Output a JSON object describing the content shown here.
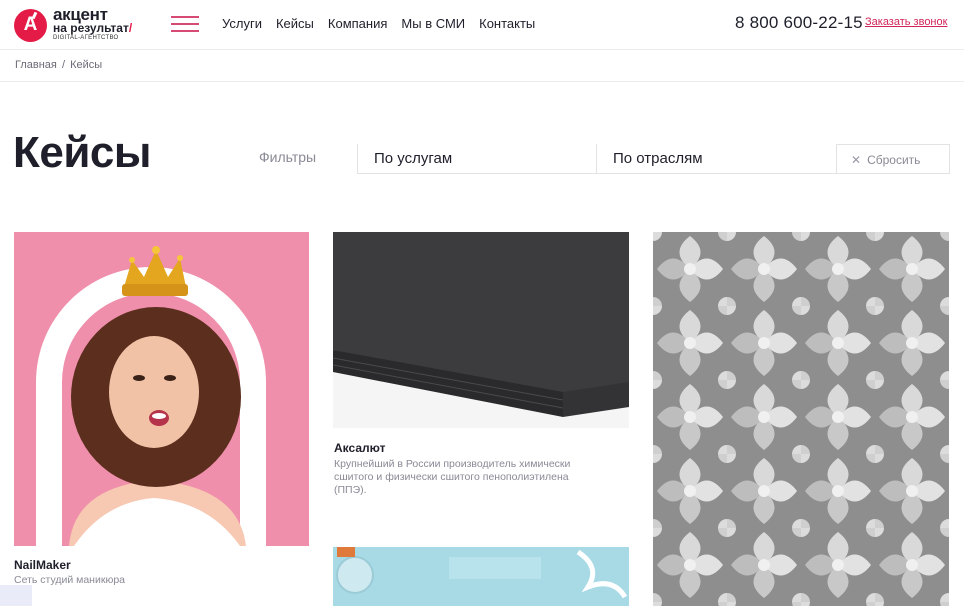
{
  "header": {
    "logo": {
      "letter": "A",
      "line1": "акцент",
      "line2": "на результат",
      "line2_mark": "/",
      "line3": "DIGITAL-АГЕНТСТВО"
    },
    "nav": [
      "Услуги",
      "Кейсы",
      "Компания",
      "Мы в СМИ",
      "Контакты"
    ],
    "phone": "8 800 600-22-15",
    "callback_label": "Заказать звонок"
  },
  "breadcrumb": {
    "home": "Главная",
    "separator": "/",
    "current": "Кейсы"
  },
  "page": {
    "title": "Кейсы"
  },
  "filters": {
    "label": "Фильтры",
    "services": "По услугам",
    "industries": "По отраслям",
    "reset_label": "Сбросить",
    "reset_icon": "close-icon"
  },
  "cases": [
    {
      "title": "NailMaker",
      "description": "Сеть студий маникюра"
    },
    {
      "title": "Аксалют",
      "description": "Крупнейший в России производитель химически сшитого и физически сшитого пенополиэтилена (ППЭ)."
    }
  ],
  "colors": {
    "accent": "#e31b46",
    "burger": "#d64a73",
    "link": "#d1245a",
    "text": "#1f1f2b",
    "muted": "#8a8a96"
  }
}
